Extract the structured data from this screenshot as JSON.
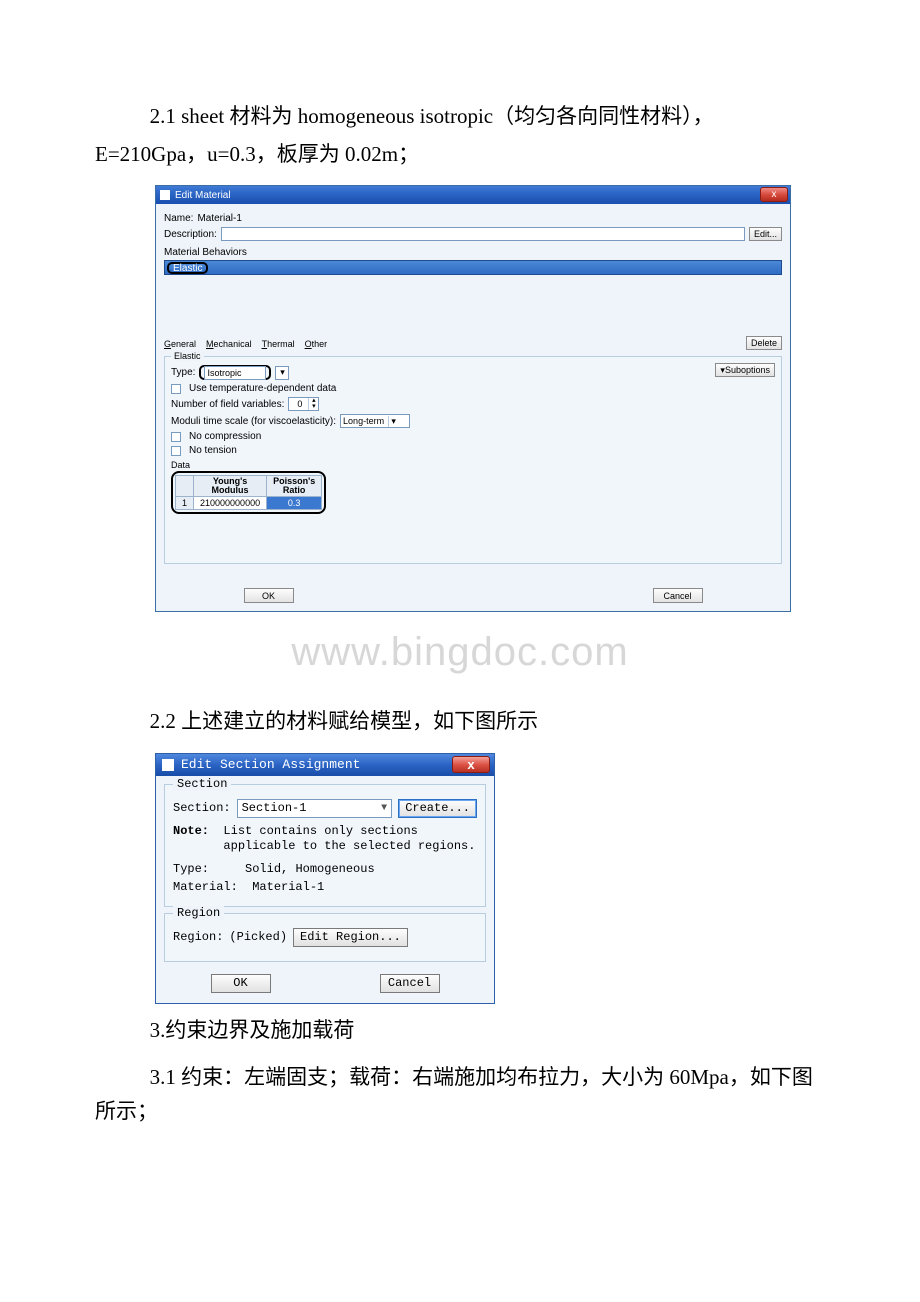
{
  "text": {
    "p1_a": "2.1 sheet 材料为 homogeneous isotropic（均匀各向同性材料），",
    "p1_b": "E=210Gpa，u=0.3，板厚为 0.02m；",
    "watermark": "www.bingdoc.com",
    "p2": "2.2 上述建立的材料赋给模型，如下图所示",
    "p3": "3.约束边界及施加载荷",
    "p4": "3.1 约束：左端固支；载荷：右端施加均布拉力，大小为 60Mpa，如下图所示；"
  },
  "dlg1": {
    "title": "Edit Material",
    "close": "x",
    "name_label": "Name:",
    "name_value": "Material-1",
    "desc_label": "Description:",
    "edit_btn": "Edit...",
    "behaviors_label": "Material Behaviors",
    "elastic_item": "Elastic",
    "tabs": {
      "general": "General",
      "mechanical": "Mechanical",
      "thermal": "Thermal",
      "other": "Other"
    },
    "delete_btn": "Delete",
    "elastic": {
      "title": "Elastic",
      "type_label": "Type:",
      "type_value": "Isotropic",
      "suboptions": "Suboptions",
      "tempdep": "Use temperature-dependent data",
      "nfield_label": "Number of field variables:",
      "nfield_value": "0",
      "moduli_label": "Moduli time scale (for viscoelasticity):",
      "moduli_value": "Long-term",
      "no_comp": "No compression",
      "no_tens": "No tension",
      "data_label": "Data",
      "col1a": "Young's",
      "col1b": "Modulus",
      "col2a": "Poisson's",
      "col2b": "Ratio",
      "row_idx": "1",
      "young": "210000000000",
      "poisson": "0.3"
    },
    "ok": "OK",
    "cancel": "Cancel"
  },
  "dlg2": {
    "title": "Edit Section Assignment",
    "close": "x",
    "section_legend": "Section",
    "section_label": "Section:",
    "section_value": "Section-1",
    "create_btn": "Create...",
    "note_bold": "Note:",
    "note_line1": "List contains only sections",
    "note_line2": "applicable to the selected regions.",
    "type_label": "Type:",
    "type_value": "Solid, Homogeneous",
    "material_label": "Material:",
    "material_value": "Material-1",
    "region_legend": "Region",
    "region_label": "Region:",
    "region_value": "(Picked)",
    "edit_region_btn": "Edit Region...",
    "ok": "OK",
    "cancel": "Cancel"
  }
}
